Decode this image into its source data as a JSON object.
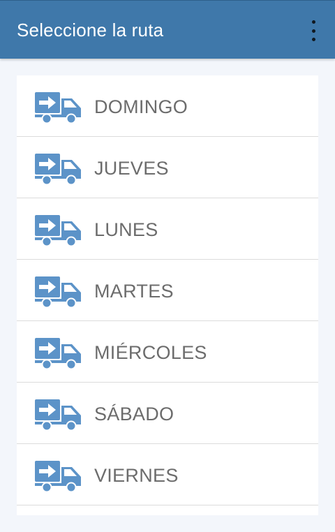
{
  "header": {
    "title": "Seleccione la ruta"
  },
  "routes": [
    {
      "label": "DOMINGO"
    },
    {
      "label": "JUEVES"
    },
    {
      "label": "LUNES"
    },
    {
      "label": "MARTES"
    },
    {
      "label": "MIÉRCOLES"
    },
    {
      "label": "SÁBADO"
    },
    {
      "label": "VIERNES"
    }
  ],
  "icons": {
    "menu": "more-vert-icon",
    "route": "delivery-truck-icon"
  },
  "colors": {
    "toolbar": "#3f78aa",
    "icon": "#5c93c8",
    "text": "#6c6c6c",
    "background": "#f3f6fb"
  }
}
